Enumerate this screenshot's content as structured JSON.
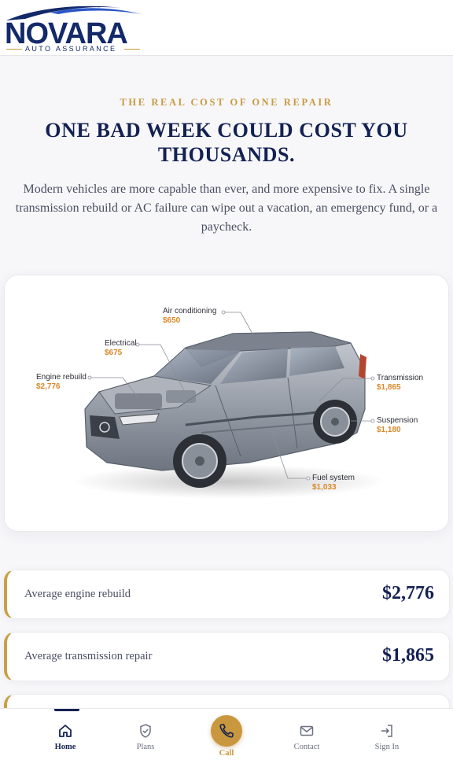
{
  "brand": {
    "name": "NOVARA",
    "tagline": "AUTO ASSURANCE",
    "navy": "#13296a",
    "gold": "#c99a42"
  },
  "hero": {
    "eyebrow": "THE REAL COST OF ONE REPAIR",
    "title": "ONE BAD WEEK COULD COST YOU THOUSANDS.",
    "intro": "Modern vehicles are more capable than ever, and more expensive to fix. A single transmission rebuild or AC failure can wipe out a vacation, an emergency fund, or a paycheck."
  },
  "car_diagram": {
    "callouts": [
      {
        "name": "Air conditioning",
        "price": "$650"
      },
      {
        "name": "Electrical",
        "price": "$675"
      },
      {
        "name": "Engine rebuild",
        "price": "$2,776"
      },
      {
        "name": "Transmission",
        "price": "$1,865"
      },
      {
        "name": "Suspension",
        "price": "$1,180"
      },
      {
        "name": "Fuel system",
        "price": "$1,033"
      }
    ]
  },
  "stats": [
    {
      "label": "Average engine rebuild",
      "value": "$2,776"
    },
    {
      "label": "Average transmission repair",
      "value": "$1,865"
    }
  ],
  "bottom_nav": {
    "items": [
      {
        "label": "Home",
        "icon": "home-icon",
        "active": true
      },
      {
        "label": "Plans",
        "icon": "shield-check-icon",
        "active": false
      },
      {
        "label": "Call",
        "icon": "phone-icon",
        "active": false
      },
      {
        "label": "Contact",
        "icon": "mail-icon",
        "active": false
      },
      {
        "label": "Sign In",
        "icon": "sign-in-icon",
        "active": false
      }
    ]
  }
}
